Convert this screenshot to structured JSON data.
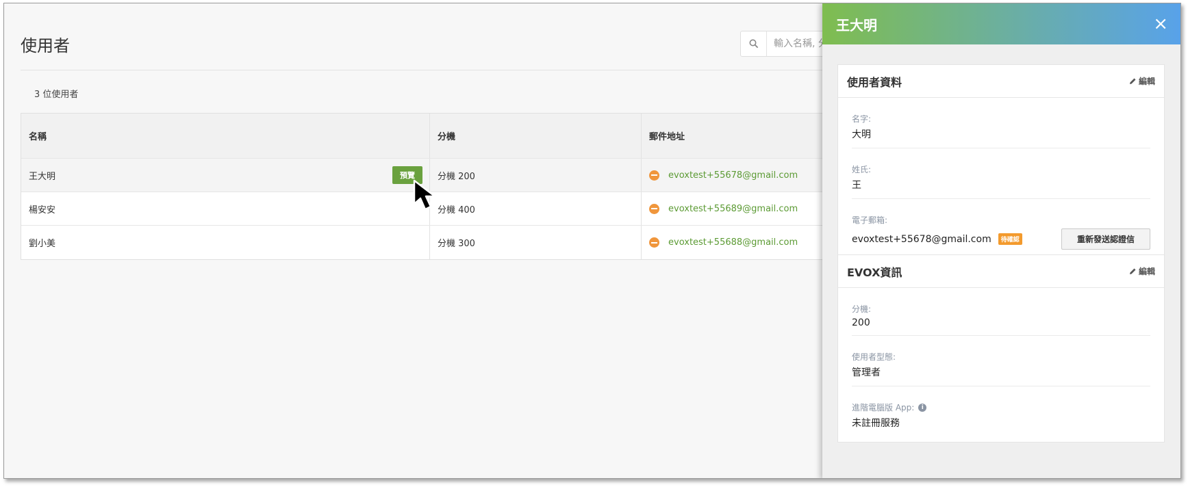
{
  "page": {
    "title": "使用者",
    "search_placeholder": "輸入名稱, 分",
    "user_count": "3 位使用者"
  },
  "table": {
    "headers": [
      "名稱",
      "分機",
      "郵件地址"
    ],
    "preview_label": "預覽",
    "rows": [
      {
        "name": "王大明",
        "ext": "分機 200",
        "email": "evoxtest+55678@gmail.com"
      },
      {
        "name": "楊安安",
        "ext": "分機 400",
        "email": "evoxtest+55689@gmail.com"
      },
      {
        "name": "劉小美",
        "ext": "分機 300",
        "email": "evoxtest+55688@gmail.com"
      }
    ]
  },
  "panel": {
    "title": "王大明",
    "close_icon": "×",
    "user_card": {
      "title": "使用者資料",
      "edit_label": "編輯",
      "first_name_label": "名字:",
      "first_name": "大明",
      "last_name_label": "姓氏:",
      "last_name": "王",
      "email_label": "電子郵箱:",
      "email": "evoxtest+55678@gmail.com",
      "pending_badge": "待確認",
      "resend_label": "重新發送認證信"
    },
    "evox_card": {
      "title": "EVOX資訊",
      "edit_label": "編輯",
      "ext_label": "分機:",
      "ext": "200",
      "type_label": "使用者型態:",
      "type": "管理者",
      "app_label": "進階電腦版 App:",
      "app_value": "未註冊服務"
    }
  },
  "colors": {
    "accent_green": "#6aa13e",
    "link_green": "#5b9a33",
    "status_orange": "#f0963c",
    "header_gradient_start": "#7fbd4f",
    "header_gradient_end": "#58a2ea"
  }
}
